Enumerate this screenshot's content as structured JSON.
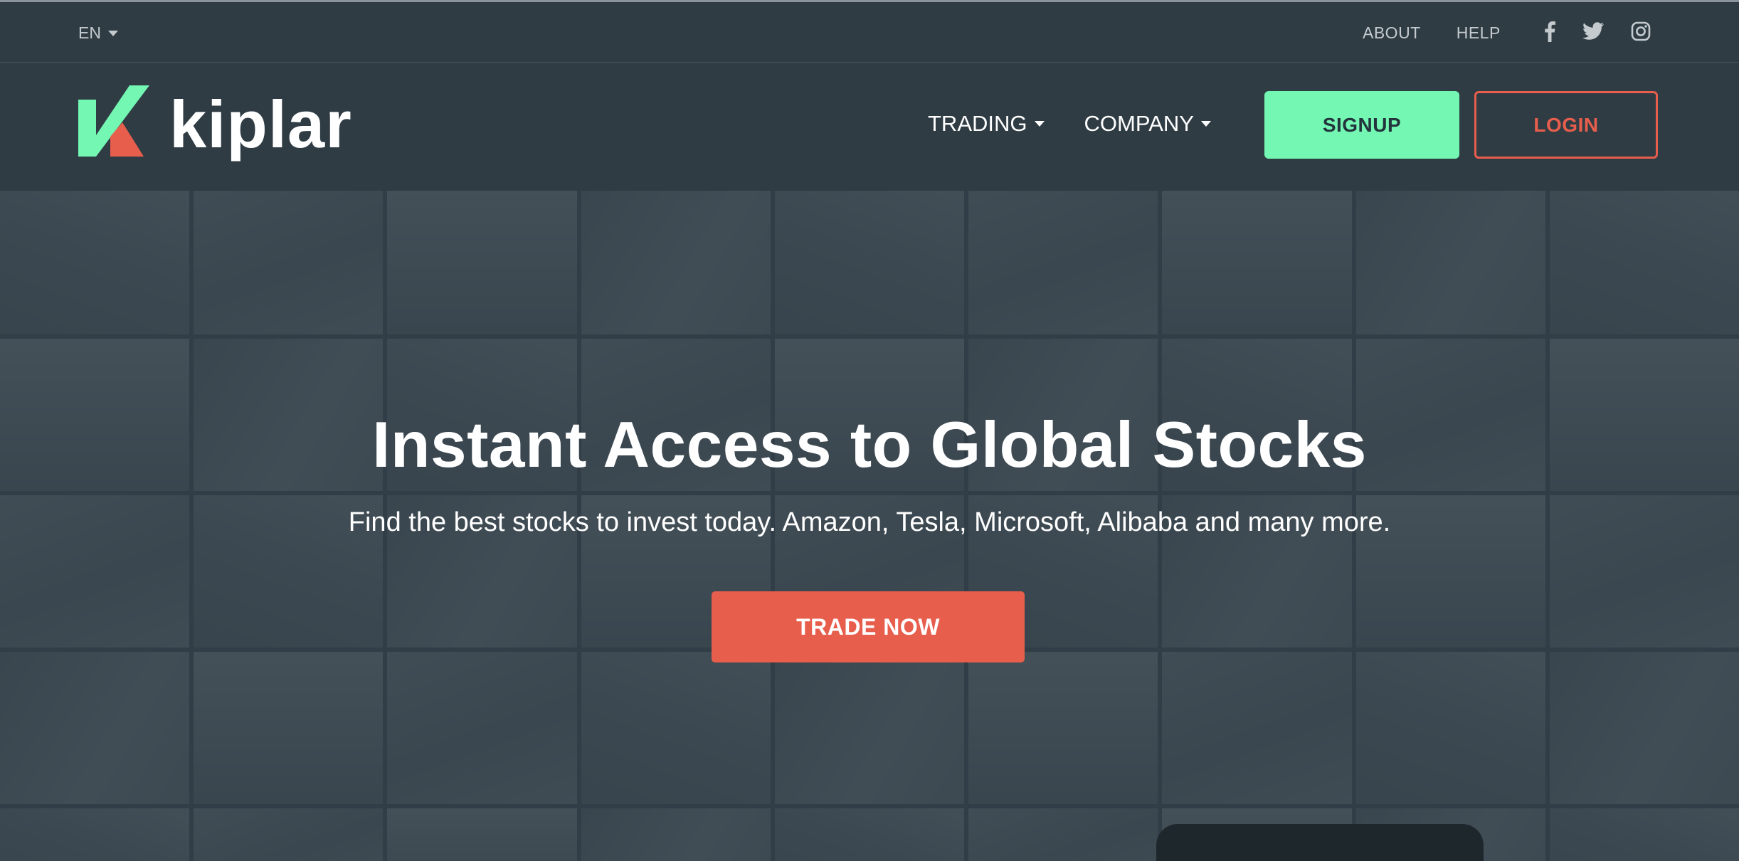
{
  "topbar": {
    "language": "EN",
    "links": [
      "ABOUT",
      "HELP"
    ],
    "social": [
      "facebook-icon",
      "twitter-icon",
      "instagram-icon"
    ]
  },
  "nav": {
    "brand": "kiplar",
    "menu": [
      "TRADING",
      "COMPANY"
    ],
    "signup_label": "SIGNUP",
    "login_label": "LOGIN"
  },
  "hero": {
    "headline": "Instant Access to Global Stocks",
    "subheadline": "Find the best stocks to invest today. Amazon, Tesla, Microsoft, Alibaba and many more.",
    "cta_label": "TRADE NOW"
  },
  "colors": {
    "background": "#2f3c44",
    "accent_green": "#74f7b2",
    "accent_red": "#e85e4d"
  }
}
